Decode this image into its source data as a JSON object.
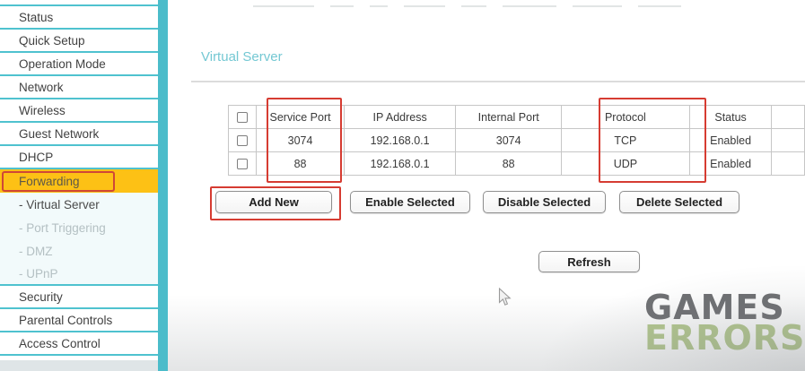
{
  "sidebar": {
    "items": [
      {
        "label": "Status",
        "cls": "normal"
      },
      {
        "label": "Quick Setup",
        "cls": "normal"
      },
      {
        "label": "Operation Mode",
        "cls": "normal"
      },
      {
        "label": "Network",
        "cls": "normal"
      },
      {
        "label": "Wireless",
        "cls": "normal"
      },
      {
        "label": "Guest Network",
        "cls": "normal"
      },
      {
        "label": "DHCP",
        "cls": "normal"
      },
      {
        "label": "Forwarding",
        "cls": "highlight",
        "annotated": true
      },
      {
        "label": "- Virtual Server",
        "cls": "sub-active"
      },
      {
        "label": "- Port Triggering",
        "cls": "sub"
      },
      {
        "label": "- DMZ",
        "cls": "sub"
      },
      {
        "label": "- UPnP",
        "cls": "sub-end"
      },
      {
        "label": "Security",
        "cls": "normal"
      },
      {
        "label": "Parental Controls",
        "cls": "normal"
      },
      {
        "label": "Access Control",
        "cls": "normal"
      }
    ]
  },
  "main": {
    "title": "Virtual Server",
    "table": {
      "columns": [
        "Service Port",
        "IP Address",
        "Internal Port",
        "Protocol",
        "Status"
      ],
      "rows": [
        {
          "service_port": "3074",
          "ip_address": "192.168.0.1",
          "internal_port": "3074",
          "protocol": "TCP",
          "status": "Enabled"
        },
        {
          "service_port": "88",
          "ip_address": "192.168.0.1",
          "internal_port": "88",
          "protocol": "UDP",
          "status": "Enabled"
        }
      ]
    },
    "buttons": {
      "add_new": "Add New",
      "enable_selected": "Enable Selected",
      "disable_selected": "Disable Selected",
      "delete_selected": "Delete Selected",
      "refresh": "Refresh"
    }
  },
  "watermark": {
    "line1": "GAMES",
    "line2": "ERRORS"
  },
  "colors": {
    "accent_teal": "#4bbcca",
    "highlight_yellow": "#fdc115",
    "annotation_red": "#d63c32",
    "watermark_gray": "#6e6f72",
    "watermark_green": "#b5ca8f"
  }
}
